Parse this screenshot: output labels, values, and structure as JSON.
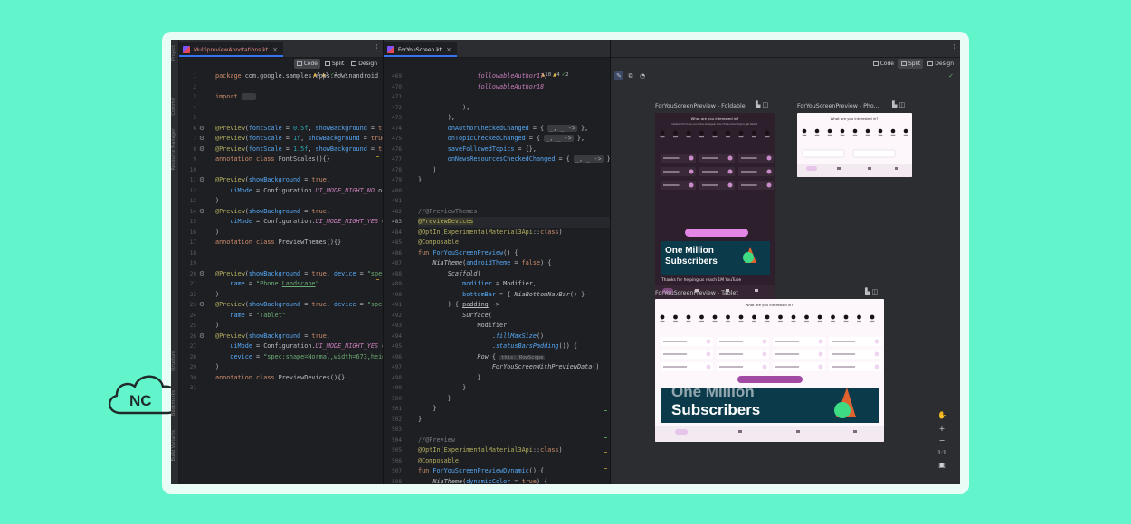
{
  "logo": {
    "text": "NC"
  },
  "tabs": {
    "left": {
      "name": "MultipreviewAnnotations.kt"
    },
    "right": {
      "name": "ForYouScreen.kt"
    }
  },
  "mode_switch": {
    "code": "Code",
    "split": "Split",
    "design": "Design"
  },
  "side_labels": [
    "Project",
    "Commit",
    "Resource Manager",
    "Structure",
    "Bookmarks",
    "Build Variants"
  ],
  "left_editor": {
    "inspection": {
      "warnings": "2",
      "weak": "3",
      "ok": "2"
    },
    "lines": [
      {
        "n": "1",
        "html": "<span class=\"kw\">package</span> com.google.samples.apps.nowinandroid"
      },
      {
        "n": "2",
        "html": ""
      },
      {
        "n": "3",
        "html": "<span class=\"kw\">import</span> <span class=\"fold\">...</span>"
      },
      {
        "n": "4",
        "html": ""
      },
      {
        "n": "5",
        "html": ""
      },
      {
        "n": "6",
        "html": "<span class=\"ann\">@Preview</span>(<span class=\"param\">fontScale</span> = <span class=\"num\">0.5f</span>, <span class=\"param\">showBackground</span> = <span class=\"kw\">true</span>)"
      },
      {
        "n": "7",
        "html": "<span class=\"ann\">@Preview</span>(<span class=\"param\">fontScale</span> = <span class=\"num\">1f</span>, <span class=\"param\">showBackground</span> = <span class=\"kw\">true</span>)"
      },
      {
        "n": "8",
        "html": "<span class=\"ann\">@Preview</span>(<span class=\"param\">fontScale</span> = <span class=\"num\">1.5f</span>, <span class=\"param\">showBackground</span> = <span class=\"kw\">true</span>)"
      },
      {
        "n": "9",
        "html": "<span class=\"kw\">annotation class</span> FontScales(){}"
      },
      {
        "n": "10",
        "html": ""
      },
      {
        "n": "11",
        "html": "<span class=\"ann\">@Preview</span>(<span class=\"param\">showBackground</span> = <span class=\"kw\">true</span>,"
      },
      {
        "n": "12",
        "html": "    <span class=\"param\">uiMode</span> = Configuration.<span class=\"it\">UI_MODE_NIGHT_NO</span> or"
      },
      {
        "n": "13",
        "html": ")"
      },
      {
        "n": "14",
        "html": "<span class=\"ann\">@Preview</span>(<span class=\"param\">showBackground</span> = <span class=\"kw\">true</span>,"
      },
      {
        "n": "15",
        "html": "    <span class=\"param\">uiMode</span> = Configuration.<span class=\"it\">UI_MODE_NIGHT_YES</span> or"
      },
      {
        "n": "16",
        "html": ")"
      },
      {
        "n": "17",
        "html": "<span class=\"kw\">annotation class</span> PreviewThemes(){}"
      },
      {
        "n": "18",
        "html": ""
      },
      {
        "n": "19",
        "html": ""
      },
      {
        "n": "20",
        "html": "<span class=\"ann\">@Preview</span>(<span class=\"param\">showBackground</span> = <span class=\"kw\">true</span>, <span class=\"param\">device</span> = <span class=\"str\">\"spec:</span>"
      },
      {
        "n": "21",
        "html": "    <span class=\"param\">name</span> = <span class=\"str\">\"Phone <u>Landscape</u>\"</span>"
      },
      {
        "n": "22",
        "html": ")"
      },
      {
        "n": "23",
        "html": "<span class=\"ann\">@Preview</span>(<span class=\"param\">showBackground</span> = <span class=\"kw\">true</span>, <span class=\"param\">device</span> = <span class=\"str\">\"spec:</span>"
      },
      {
        "n": "24",
        "html": "    <span class=\"param\">name</span> = <span class=\"str\">\"Tablet\"</span>"
      },
      {
        "n": "25",
        "html": ")"
      },
      {
        "n": "26",
        "html": "<span class=\"ann\">@Preview</span>(<span class=\"param\">showBackground</span> = <span class=\"kw\">true</span>,"
      },
      {
        "n": "27",
        "html": "    <span class=\"param\">uiMode</span> = Configuration.<span class=\"it\">UI_MODE_NIGHT_YES</span> or"
      },
      {
        "n": "28",
        "html": "    <span class=\"param\">device</span> = <span class=\"str\">\"spec:shape=Normal,width=673,heigh</span>"
      },
      {
        "n": "29",
        "html": ")"
      },
      {
        "n": "30",
        "html": "<span class=\"kw\">annotation class</span> PreviewDevices(){}"
      },
      {
        "n": "31",
        "html": ""
      }
    ]
  },
  "right_editor": {
    "inspection": {
      "warnings": "18",
      "weak": "4",
      "ok": "2"
    },
    "lines": [
      {
        "n": "469",
        "html": "                <span class=\"it\">followableAuthor17</span>,"
      },
      {
        "n": "470",
        "html": "                <span class=\"it\">followableAuthor18</span>"
      },
      {
        "n": "471",
        "html": ""
      },
      {
        "n": "472",
        "html": "            ),"
      },
      {
        "n": "473",
        "html": "        ),"
      },
      {
        "n": "474",
        "html": "        <span class=\"param\">onAuthorCheckedChanged</span> = { <span class=\"fold\">_, _ -&gt;</span> },"
      },
      {
        "n": "475",
        "html": "        <span class=\"param\">onTopicCheckedChanged</span> = { <span class=\"fold\">_, _ -&gt;</span> },"
      },
      {
        "n": "476",
        "html": "        <span class=\"param\">saveFollowedTopics</span> = {},"
      },
      {
        "n": "477",
        "html": "        <span class=\"param\">onNewsResourcesCheckedChanged</span> = { <span class=\"fold\">_, _ -&gt;</span> }"
      },
      {
        "n": "478",
        "html": "    )"
      },
      {
        "n": "479",
        "html": "}"
      },
      {
        "n": "480",
        "html": ""
      },
      {
        "n": "481",
        "html": ""
      },
      {
        "n": "482",
        "html": "<span style=\"color:#7a7e85\">//@PreviewThemes</span>"
      },
      {
        "n": "483",
        "html": "<span class=\"ann\" style=\"background:#3a3a2c\">@PreviewDevices</span>"
      },
      {
        "n": "484",
        "html": "<span class=\"ann\">@OptIn</span>(<span class=\"ann\">ExperimentalMaterial3Api</span>::<span class=\"kw\">class</span>)"
      },
      {
        "n": "485",
        "html": "<span class=\"ann\">@Composable</span>"
      },
      {
        "n": "486",
        "html": "<span class=\"kw\">fun</span> <span class=\"fn\">ForYouScreenPreview</span>() {"
      },
      {
        "n": "487",
        "html": "    <span class=\"ital\">NiaTheme</span>(<span class=\"param\">androidTheme</span> = <span class=\"kw\">false</span>) {"
      },
      {
        "n": "488",
        "html": "        <span class=\"ital\">Scaffold</span>("
      },
      {
        "n": "489",
        "html": "            <span class=\"param\">modifier</span> = Modifier,"
      },
      {
        "n": "490",
        "html": "            <span class=\"param\">bottomBar</span> = { <span class=\"ital\">NiaBottomNavBar</span>() }"
      },
      {
        "n": "491",
        "html": "        ) { <u>padding</u> -&gt;"
      },
      {
        "n": "492",
        "html": "            <span class=\"ital\">Surface</span>("
      },
      {
        "n": "493",
        "html": "                Modifier"
      },
      {
        "n": "494",
        "html": "                    .<span class=\"fn ital\">fillMaxSize</span>()"
      },
      {
        "n": "495",
        "html": "                    .<span class=\"fn ital\">statusBarsPadding</span>()) {"
      },
      {
        "n": "496",
        "html": "                <span class=\"ital\">Row</span> { <span class=\"hintbox\">this: RowScope</span>"
      },
      {
        "n": "497",
        "html": "                    <span class=\"ital\">ForYouScreenWithPreviewData</span>()"
      },
      {
        "n": "498",
        "html": "                }"
      },
      {
        "n": "499",
        "html": "            }"
      },
      {
        "n": "500",
        "html": "        }"
      },
      {
        "n": "501",
        "html": "    }"
      },
      {
        "n": "502",
        "html": "}"
      },
      {
        "n": "503",
        "html": ""
      },
      {
        "n": "504",
        "html": "<span style=\"color:#7a7e85\">//@Preview</span>"
      },
      {
        "n": "505",
        "html": "<span class=\"ann\">@OptIn</span>(<span class=\"ann\">ExperimentalMaterial3Api</span>::<span class=\"kw\">class</span>)"
      },
      {
        "n": "506",
        "html": "<span class=\"ann\">@Composable</span>"
      },
      {
        "n": "507",
        "html": "<span class=\"kw\">fun</span> <span class=\"fn\">ForYouScreenPreviewDynamic</span>() {"
      },
      {
        "n": "508",
        "html": "    <span class=\"ital\">NiaTheme</span>(<span class=\"param\">dynamicColor</span> = <span class=\"kw\">true</span>) {"
      }
    ]
  },
  "previews": {
    "foldable": {
      "title": "ForYouScreenPreview - Foldable",
      "heading": "What are you interested in?",
      "sub": "Updates from topics you follow will appear here. Follow some things to get started.",
      "banner": "One Million\nSubscribers",
      "caption": "Thanks for helping us reach 1M YouTube"
    },
    "phone": {
      "title": "ForYouScreenPreview - Pho...",
      "heading": "What are you interested in?"
    },
    "tablet": {
      "title": "ForYouScreenPreview - Tablet",
      "heading": "What are you interested in?",
      "banner": "One Million\nSubscribers"
    }
  },
  "colors": {
    "accent": "#3574f0",
    "preview_bg_dark": "#2d1f2b",
    "preview_accent": "#e486e6",
    "banner": "#0b3b4b",
    "green_bg": "#62f5cc"
  }
}
